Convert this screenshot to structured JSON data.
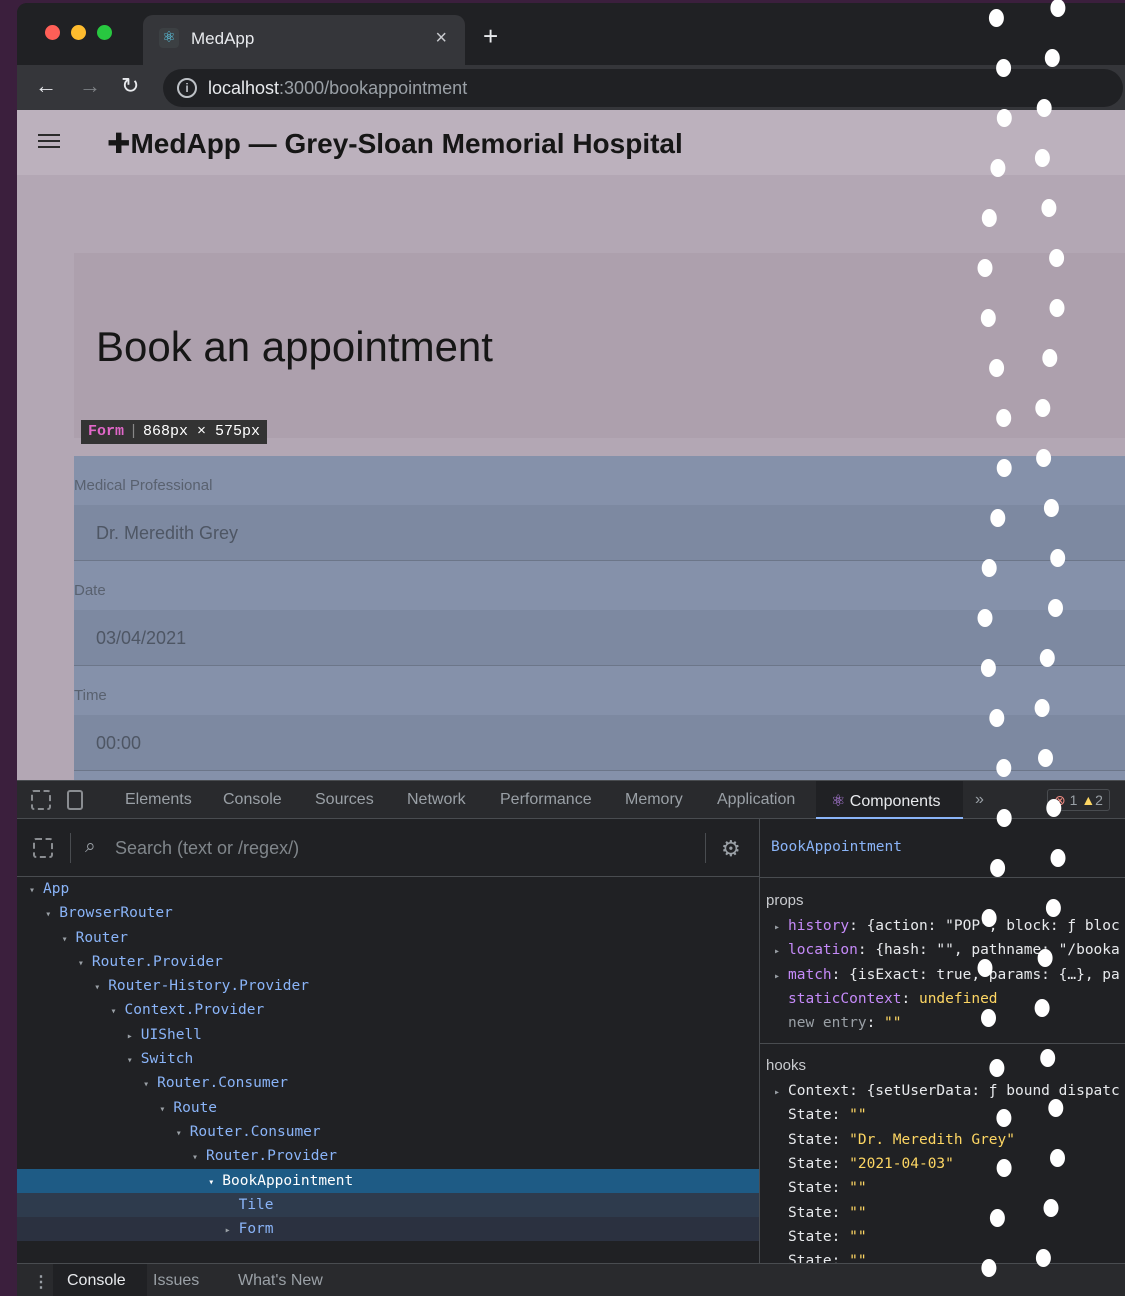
{
  "browser": {
    "tab_title": "MedApp",
    "tab_close": "×",
    "new_tab": "+",
    "url_host": "localhost",
    "url_rest": ":3000/bookappointment",
    "back": "←",
    "forward": "→",
    "reload": "↻"
  },
  "app": {
    "title": "MedApp — Grey-Sloan Memorial Hospital",
    "logo_glyph": "✚",
    "heading": "Book an appointment",
    "overlay": {
      "tag": "Form",
      "size": "868px × 575px"
    },
    "fields": [
      {
        "label": "Medical Professional",
        "value": "Dr. Meredith Grey"
      },
      {
        "label": "Date",
        "value": "03/04/2021"
      },
      {
        "label": "Time",
        "value": "00:00"
      }
    ]
  },
  "devtools": {
    "tabs": [
      "Elements",
      "Console",
      "Sources",
      "Network",
      "Performance",
      "Memory",
      "Application",
      "Components"
    ],
    "more": "»",
    "errors": "1",
    "warnings": "2",
    "search_placeholder": "Search (text or /regex/)",
    "tree": [
      {
        "label": "App",
        "depth": 0,
        "arrow": "▾"
      },
      {
        "label": "BrowserRouter",
        "depth": 1,
        "arrow": "▾"
      },
      {
        "label": "Router",
        "depth": 2,
        "arrow": "▾"
      },
      {
        "label": "Router.Provider",
        "depth": 3,
        "arrow": "▾"
      },
      {
        "label": "Router-History.Provider",
        "depth": 4,
        "arrow": "▾"
      },
      {
        "label": "Context.Provider",
        "depth": 5,
        "arrow": "▾"
      },
      {
        "label": "UIShell",
        "depth": 6,
        "arrow": "▸"
      },
      {
        "label": "Switch",
        "depth": 6,
        "arrow": "▾"
      },
      {
        "label": "Router.Consumer",
        "depth": 7,
        "arrow": "▾"
      },
      {
        "label": "Route",
        "depth": 8,
        "arrow": "▾"
      },
      {
        "label": "Router.Consumer",
        "depth": 9,
        "arrow": "▾"
      },
      {
        "label": "Router.Provider",
        "depth": 10,
        "arrow": "▾"
      },
      {
        "label": "BookAppointment",
        "depth": 11,
        "arrow": "▾",
        "selected": true
      },
      {
        "label": "Tile",
        "depth": 12,
        "arrow": ""
      },
      {
        "label": "Form",
        "depth": 12,
        "arrow": "▸"
      }
    ],
    "component": "BookAppointment",
    "props_title": "props",
    "props": [
      {
        "arrow": "▸",
        "key": "history",
        "value": "{action: \"POP\", block: ƒ bloc"
      },
      {
        "arrow": "▸",
        "key": "location",
        "value": "{hash: \"\", pathname: \"/booka"
      },
      {
        "arrow": "▸",
        "key": "match",
        "value": "{isExact: true, params: {…}, pa"
      },
      {
        "arrow": "",
        "key": "staticContext",
        "value": "undefined"
      },
      {
        "arrow": "",
        "key": "new entry",
        "value": "\"\""
      }
    ],
    "hooks_title": "hooks",
    "hooks": [
      {
        "arrow": "▸",
        "key": "Context",
        "value": "{setUserData: ƒ bound dispatc"
      },
      {
        "arrow": "",
        "key": "State",
        "value": "\"\""
      },
      {
        "arrow": "",
        "key": "State",
        "value": "\"Dr. Meredith Grey\""
      },
      {
        "arrow": "",
        "key": "State",
        "value": "\"2021-04-03\""
      },
      {
        "arrow": "",
        "key": "State",
        "value": "\"\""
      },
      {
        "arrow": "",
        "key": "State",
        "value": "\"\""
      },
      {
        "arrow": "",
        "key": "State",
        "value": "\"\""
      },
      {
        "arrow": "",
        "key": "State",
        "value": "\"\""
      }
    ],
    "drawer_tabs": [
      "Console",
      "Issues",
      "What's New"
    ]
  },
  "colors": {
    "close": "#ff5f57",
    "minimize": "#febc2e",
    "maximize": "#28c840",
    "accent": "#8ab4f8"
  }
}
